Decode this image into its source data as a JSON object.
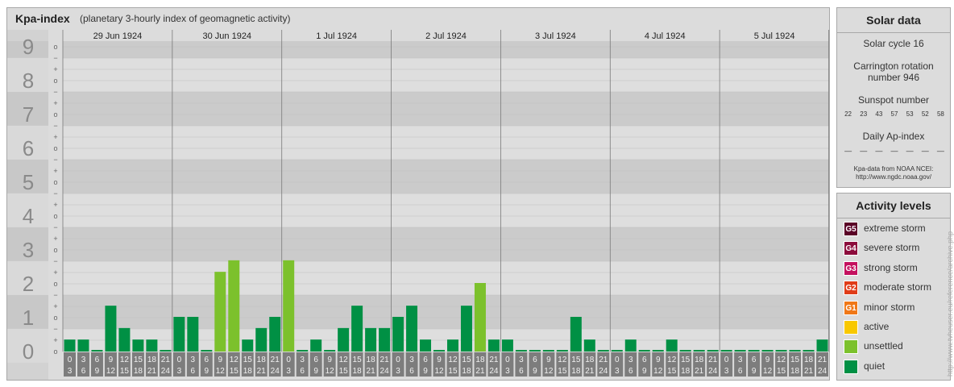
{
  "header": {
    "title": "Kpa-index",
    "subtitle": "(planetary 3-hourly index of geomagnetic activity)"
  },
  "chart_data": {
    "type": "bar",
    "days": [
      "29 Jun 1924",
      "30 Jun 1924",
      "1 Jul 1924",
      "2 Jul 1924",
      "3 Jul 1924",
      "4 Jul 1924",
      "5 Jul 1924"
    ],
    "levels": [
      "0",
      "1",
      "2",
      "3",
      "4",
      "5",
      "6",
      "7",
      "8",
      "9"
    ],
    "sublabels": [
      "+",
      "o",
      "−"
    ],
    "interval_start": [
      "0",
      "3",
      "6",
      "9",
      "12",
      "15",
      "18",
      "21"
    ],
    "interval_end": [
      "3",
      "6",
      "9",
      "12",
      "15",
      "18",
      "21",
      "24"
    ],
    "ylim": [
      0,
      9.67
    ],
    "values": [
      0.33,
      0.33,
      0,
      1.33,
      0.67,
      0.33,
      0.33,
      0,
      1,
      1,
      0,
      2.33,
      2.67,
      0.33,
      0.67,
      1,
      2.67,
      0,
      0.33,
      0,
      0.67,
      1.33,
      0.67,
      0.67,
      1,
      1.33,
      0.33,
      0,
      0.33,
      1.33,
      2,
      0.33,
      0.33,
      0,
      0,
      0,
      0,
      1,
      0.33,
      0,
      0,
      0.33,
      0,
      0,
      0.33,
      0,
      0,
      0,
      0,
      0,
      0,
      0,
      0,
      0,
      0,
      0.33
    ],
    "colors": {
      "quiet": "#009044",
      "unsettled": "#7cc12c"
    }
  },
  "solar": {
    "heading": "Solar data",
    "cycle": "Solar cycle 16",
    "rotation_1": "Carrington rotation",
    "rotation_2": "number 946",
    "sunspot_label": "Sunspot number",
    "sunspots": [
      "22",
      "23",
      "43",
      "57",
      "53",
      "52",
      "58"
    ],
    "ap_label": "Daily Ap-index",
    "ap_values": [
      "—",
      "—",
      "—",
      "—",
      "—",
      "—",
      "—"
    ],
    "source_1": "Kpa-data from NOAA NCEI:",
    "source_2": "http://www.ngdc.noaa.gov/"
  },
  "activity": {
    "heading": "Activity levels",
    "items": [
      {
        "code": "G5",
        "label": "extreme storm",
        "color": "#5a0026"
      },
      {
        "code": "G4",
        "label": "severe storm",
        "color": "#8c0c3c"
      },
      {
        "code": "G3",
        "label": "strong storm",
        "color": "#c4105e"
      },
      {
        "code": "G2",
        "label": "moderate storm",
        "color": "#e03c18"
      },
      {
        "code": "G1",
        "label": "minor storm",
        "color": "#f07818"
      },
      {
        "code": "",
        "label": "active",
        "color": "#f8c800"
      },
      {
        "code": "",
        "label": "unsettled",
        "color": "#7cc12c"
      },
      {
        "code": "",
        "label": "quiet",
        "color": "#009044"
      }
    ]
  },
  "credit": "http://www.tvheuser.eu/reference/archive.php"
}
